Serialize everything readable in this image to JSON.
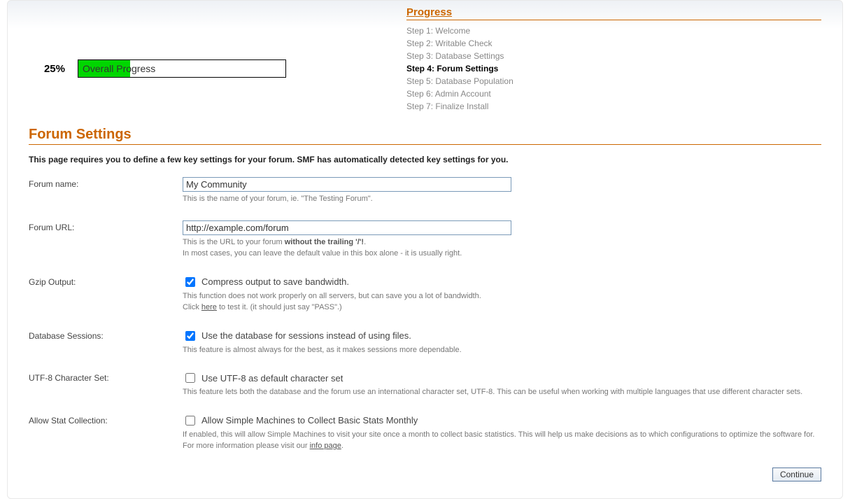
{
  "progress": {
    "percent_label": "25%",
    "percent_value": 25,
    "bar_label": "Overall Progress"
  },
  "steps": {
    "title": "Progress",
    "items": [
      {
        "label": "Step 1: Welcome",
        "current": false
      },
      {
        "label": "Step 2: Writable Check",
        "current": false
      },
      {
        "label": "Step 3: Database Settings",
        "current": false
      },
      {
        "label": "Step 4: Forum Settings",
        "current": true
      },
      {
        "label": "Step 5: Database Population",
        "current": false
      },
      {
        "label": "Step 6: Admin Account",
        "current": false
      },
      {
        "label": "Step 7: Finalize Install",
        "current": false
      }
    ]
  },
  "section": {
    "heading": "Forum Settings",
    "intro": "This page requires you to define a few key settings for your forum. SMF has automatically detected key settings for you."
  },
  "fields": {
    "forum_name": {
      "label": "Forum name:",
      "value": "My Community",
      "hint": "This is the name of your forum, ie. \"The Testing Forum\"."
    },
    "forum_url": {
      "label": "Forum URL:",
      "value": "http://example.com/forum",
      "hint_pre": "This is the URL to your forum ",
      "hint_strong": "without the trailing '/'!",
      "hint_post": ".",
      "hint_line2": "In most cases, you can leave the default value in this box alone - it is usually right."
    },
    "gzip": {
      "label": "Gzip Output:",
      "check_label": "Compress output to save bandwidth.",
      "checked": true,
      "hint_line1": "This function does not work properly on all servers, but can save you a lot of bandwidth.",
      "hint_pre": "Click ",
      "hint_link": "here",
      "hint_post": " to test it. (it should just say \"PASS\".)"
    },
    "db_sessions": {
      "label": "Database Sessions:",
      "check_label": "Use the database for sessions instead of using files.",
      "checked": true,
      "hint": "This feature is almost always for the best, as it makes sessions more dependable."
    },
    "utf8": {
      "label": "UTF-8 Character Set:",
      "check_label": "Use UTF-8 as default character set",
      "checked": false,
      "hint": "This feature lets both the database and the forum use an international character set, UTF-8. This can be useful when working with multiple languages that use different character sets."
    },
    "stats": {
      "label": "Allow Stat Collection:",
      "check_label": "Allow Simple Machines to Collect Basic Stats Monthly",
      "checked": false,
      "hint_pre": "If enabled, this will allow Simple Machines to visit your site once a month to collect basic statistics. This will help us make decisions as to which configurations to optimize the software for. For more information please visit our ",
      "hint_link": "info page",
      "hint_post": "."
    }
  },
  "actions": {
    "continue": "Continue"
  }
}
